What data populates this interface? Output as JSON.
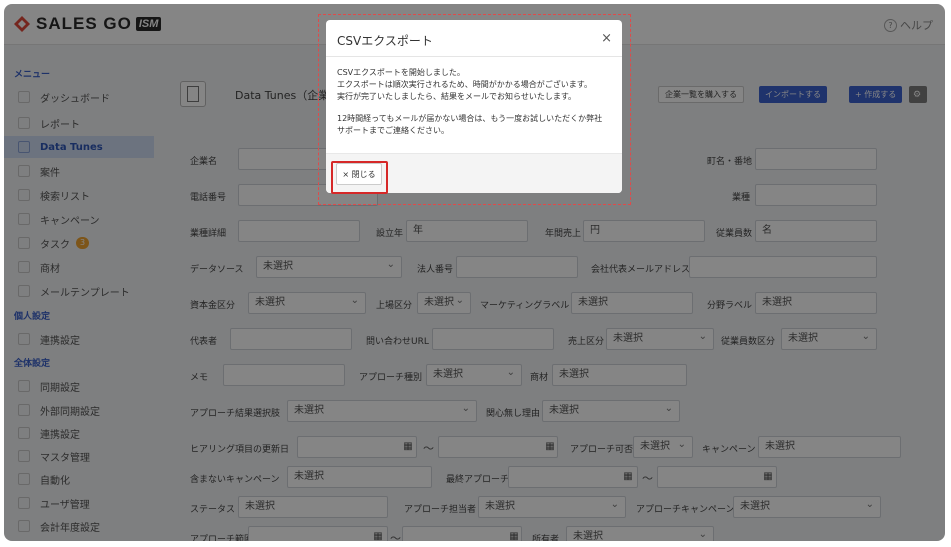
{
  "app": {
    "brand": "SALES GO",
    "brand_tag": "ISM",
    "help_label": "ヘルプ"
  },
  "sidebar": {
    "sections": [
      {
        "label": "メニュー"
      },
      {
        "label": "個人設定"
      },
      {
        "label": "全体設定"
      }
    ],
    "items": [
      {
        "label": "ダッシュボード",
        "icon": "dashboard-icon"
      },
      {
        "label": "レポート",
        "icon": "report-icon"
      },
      {
        "label": "Data Tunes",
        "icon": "building-icon",
        "active": true
      },
      {
        "label": "案件",
        "icon": "deal-icon"
      },
      {
        "label": "検索リスト",
        "icon": "search-icon"
      },
      {
        "label": "キャンペーン",
        "icon": "campaign-icon"
      },
      {
        "label": "タスク",
        "icon": "task-icon",
        "badge": "3"
      },
      {
        "label": "商材",
        "icon": "product-icon"
      },
      {
        "label": "メールテンプレート",
        "icon": "mail-icon"
      },
      {
        "label": "連携設定",
        "icon": "link-icon"
      },
      {
        "label": "同期設定",
        "icon": "sync-icon"
      },
      {
        "label": "外部同期設定",
        "icon": "cloud-icon"
      },
      {
        "label": "連携設定",
        "icon": "link-icon"
      },
      {
        "label": "マスタ管理",
        "icon": "master-icon"
      },
      {
        "label": "自動化",
        "icon": "automation-icon"
      },
      {
        "label": "ユーザ管理",
        "icon": "user-icon"
      },
      {
        "label": "会計年度設定",
        "icon": "calendar-icon"
      }
    ]
  },
  "header": {
    "title": "Data Tunes（企業一覧）",
    "buy_button": "企業一覧を購入する",
    "import_button": "インポートする",
    "create_button": "+ 作成する"
  },
  "form": {
    "company_name": "企業名",
    "address": "町名・番地",
    "phone": "電話番号",
    "industry": "業種",
    "industry_detail": "業種詳細",
    "founded": "設立年",
    "founded_unit": "年",
    "revenue": "年間売上",
    "revenue_unit": "円",
    "employees": "従業員数",
    "employees_unit": "名",
    "data_source": "データソース",
    "unselected": "未選択",
    "corp_number": "法人番号",
    "company_email": "会社代表メールアドレス",
    "capital": "資本金区分",
    "listing": "上場区分",
    "marketing_label": "マーケティングラベル",
    "field_label": "分野ラベル",
    "representative": "代表者",
    "inquiry_url": "問い合わせURL",
    "sales_class": "売上区分",
    "employee_class": "従業員数区分",
    "memo": "メモ",
    "approach_type": "アプローチ種別",
    "product": "商材",
    "approach_result": "アプローチ結果選択肢",
    "no_interest": "関心無し理由",
    "hearing_date": "ヒアリング項目の更新日",
    "approach_ok": "アプローチ可否",
    "campaign": "キャンペーン",
    "exclude_campaign": "含まないキャンペーン",
    "last_approach": "最終アプローチ",
    "status": "ステータス",
    "approach_owner": "アプローチ担当者",
    "approach_campaign": "アプローチキャンペーン",
    "approach_range": "アプローチ範囲",
    "owner": "所有者",
    "tilde": "～"
  },
  "modal": {
    "title": "CSVエクスポート",
    "line1": "CSVエクスポートを開始しました。",
    "line2": "エクスポートは順次実行されるため、時間がかかる場合がございます。",
    "line3": "実行が完了いたしましたら、結果をメールでお知らせいたします。",
    "line4": "12時間経ってもメールが届かない場合は、もう一度お試しいただくか弊社",
    "line5": "サポートまでご連絡ください。",
    "close_label": "× 閉じる",
    "close_x": "×"
  },
  "colors": {
    "accent": "#3d62d0",
    "active_bg": "#cfdcf3",
    "highlight": "#d62828",
    "badge": "#f0a431"
  }
}
